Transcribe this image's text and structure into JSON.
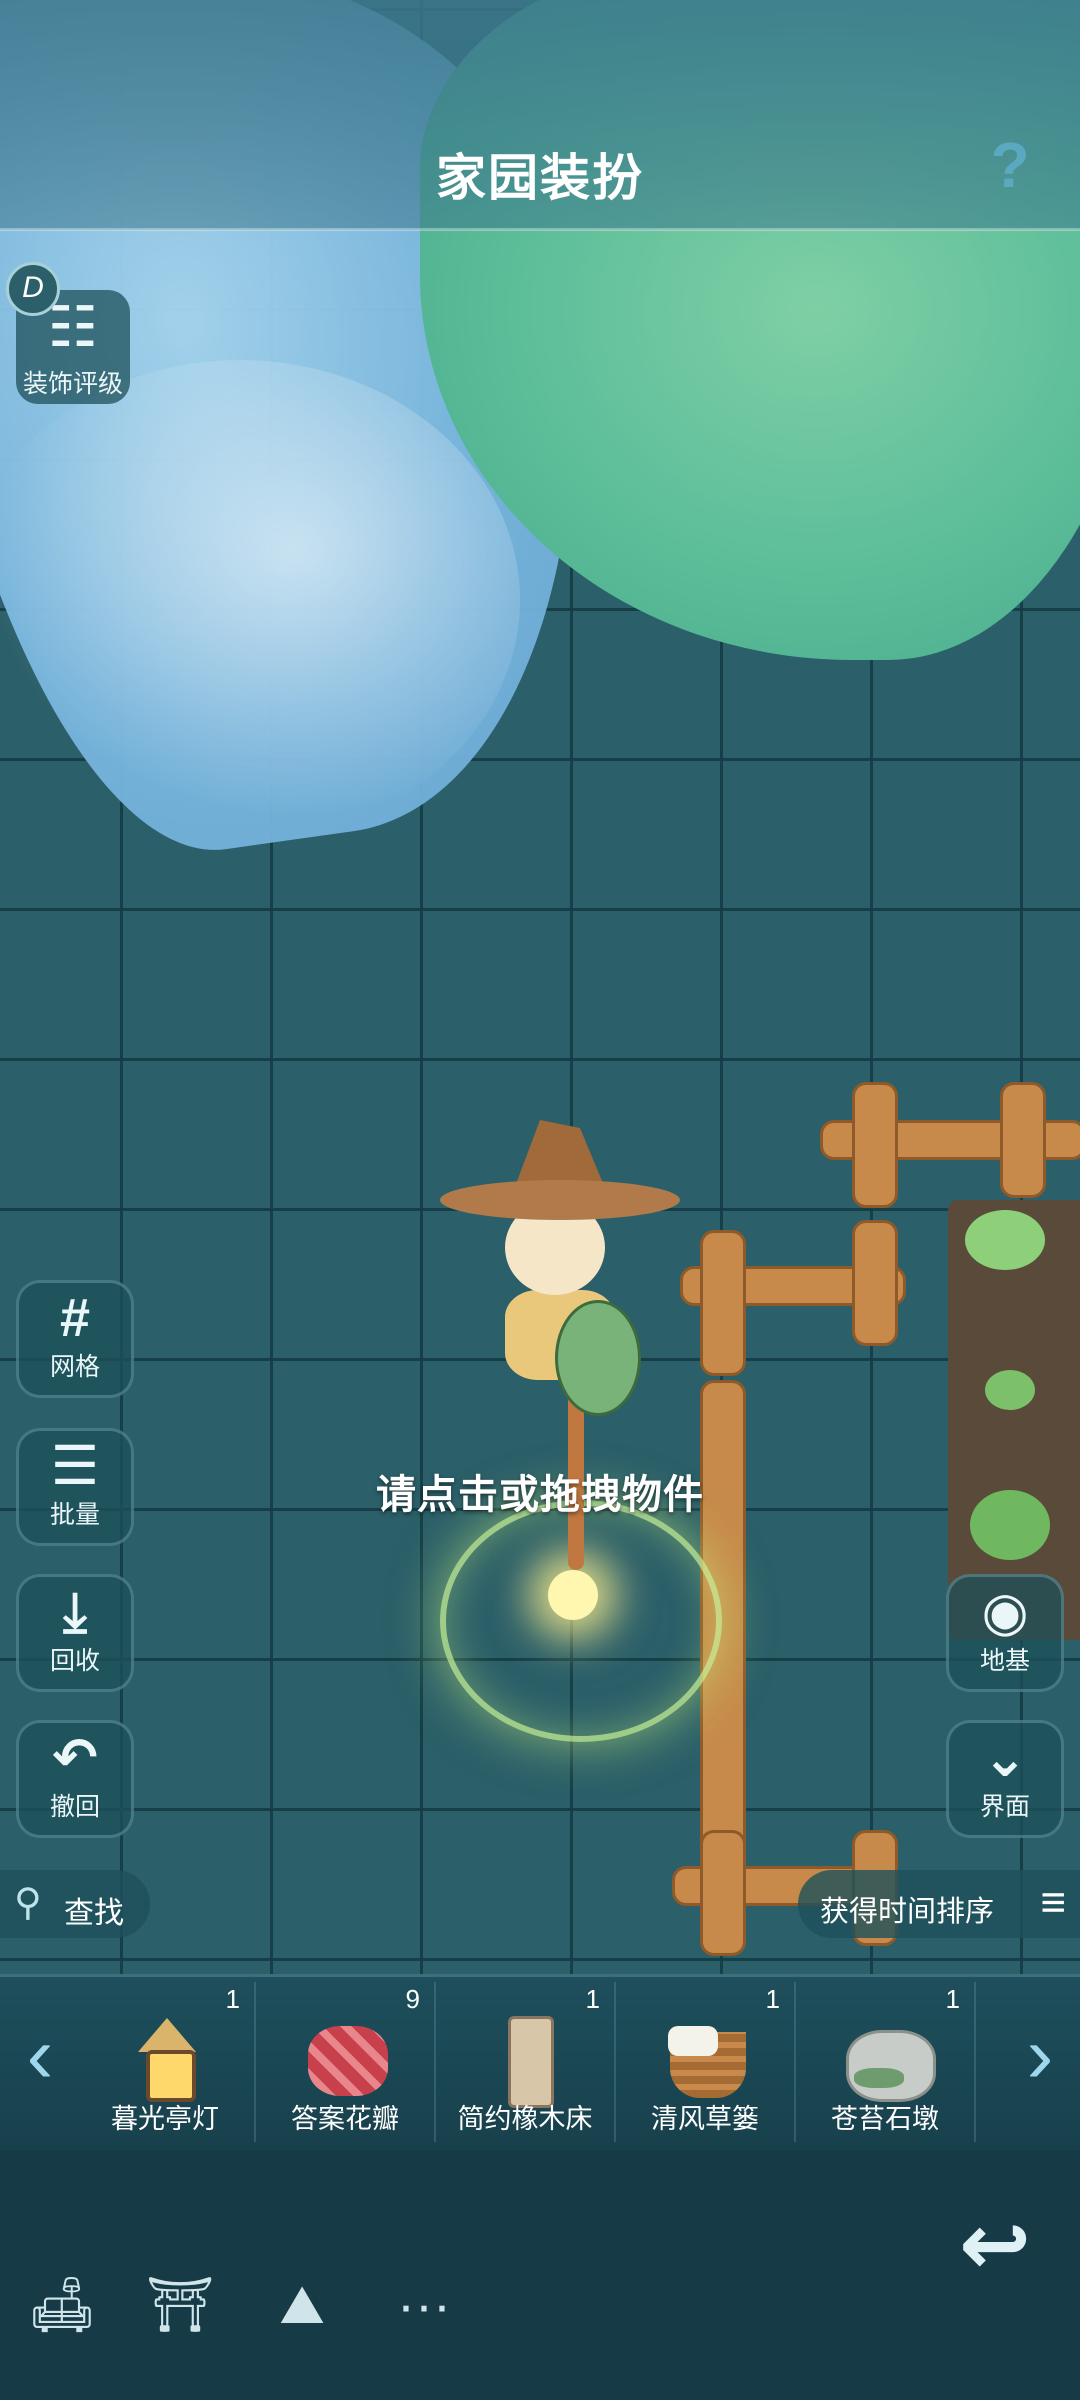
{
  "header": {
    "title": "家园装扮",
    "help_icon": "?"
  },
  "left_tools": {
    "rating": {
      "label": "装饰评级",
      "badge": "D",
      "icon": "scroll-icon"
    },
    "grid": {
      "label": "网格",
      "glyph": "#"
    },
    "batch": {
      "label": "批量",
      "glyph": "☰"
    },
    "recycle": {
      "label": "回收",
      "glyph": "⤓"
    },
    "undo": {
      "label": "撤回",
      "glyph": "↶"
    }
  },
  "right_tools": {
    "foundation": {
      "label": "地基",
      "glyph": "◉"
    },
    "interface": {
      "label": "界面",
      "glyph": "⌄"
    }
  },
  "search": {
    "label": "查找",
    "glyph": "🔍"
  },
  "sort": {
    "label": "获得时间排序",
    "glyph": "≡"
  },
  "hint": "请点击或拖拽物件",
  "inventory": {
    "left_arrow": "‹",
    "right_arrow": "›",
    "items": [
      {
        "name": "暮光亭灯",
        "count": "1"
      },
      {
        "name": "答案花瓣",
        "count": "9"
      },
      {
        "name": "简约橡木床",
        "count": "1"
      },
      {
        "name": "清风草篓",
        "count": "1"
      },
      {
        "name": "苍苔石墩",
        "count": "1"
      }
    ]
  },
  "bottom_nav": {
    "items": [
      {
        "icon": "sofa-icon",
        "glyph": "🛋"
      },
      {
        "icon": "yard-icon",
        "glyph": "⛩"
      },
      {
        "icon": "landscape-icon",
        "glyph": "⛰"
      },
      {
        "icon": "more-icon",
        "glyph": "···"
      }
    ],
    "back_glyph": "↩"
  },
  "colors": {
    "accent": "#9fd7ec",
    "panel": "#173a47",
    "grid": "#2b5f69"
  }
}
